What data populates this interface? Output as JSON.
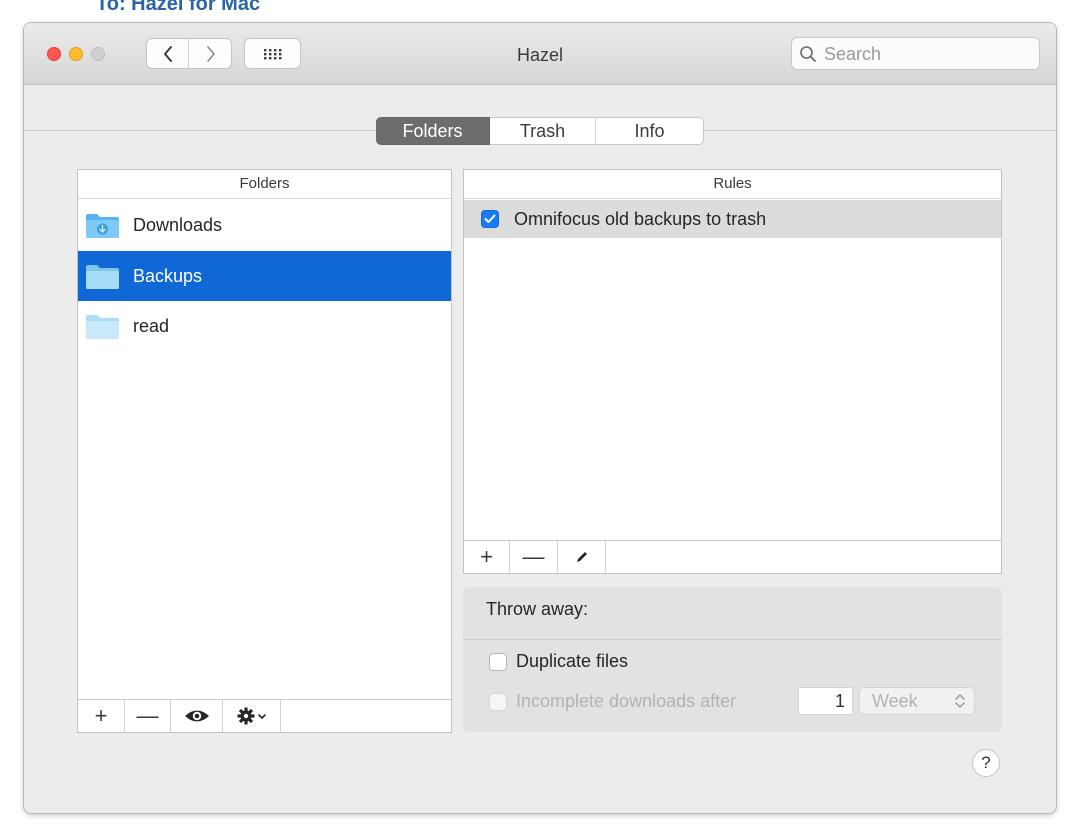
{
  "background": {
    "top_text": "To: Hazel for Mac"
  },
  "window": {
    "title": "Hazel"
  },
  "search": {
    "placeholder": "Search"
  },
  "tabs": [
    {
      "label": "Folders",
      "active": true
    },
    {
      "label": "Trash",
      "active": false
    },
    {
      "label": "Info",
      "active": false
    }
  ],
  "folders": {
    "header": "Folders",
    "items": [
      {
        "label": "Downloads",
        "selected": false,
        "icon": "downloads-folder-icon"
      },
      {
        "label": "Backups",
        "selected": true,
        "icon": "folder-icon"
      },
      {
        "label": "read",
        "selected": false,
        "icon": "folder-icon"
      }
    ],
    "toolbar": {
      "add": "+",
      "remove": "—"
    }
  },
  "rules": {
    "header": "Rules",
    "items": [
      {
        "label": "Omnifocus old backups to trash",
        "enabled": true
      }
    ],
    "toolbar": {
      "add": "+",
      "remove": "—"
    }
  },
  "throw_away": {
    "label": "Throw away:",
    "duplicate_files": {
      "label": "Duplicate files",
      "checked": false
    },
    "incomplete_downloads": {
      "label": "Incomplete downloads after",
      "checked": false,
      "disabled": true
    },
    "amount": "1",
    "unit": "Week"
  },
  "help": {
    "label": "?"
  },
  "colors": {
    "selection": "#0f68d6",
    "checkbox_on": "#1a7cf2",
    "active_tab": "#6d6d6d",
    "close": "#fd5754",
    "minimize": "#febc2e"
  }
}
